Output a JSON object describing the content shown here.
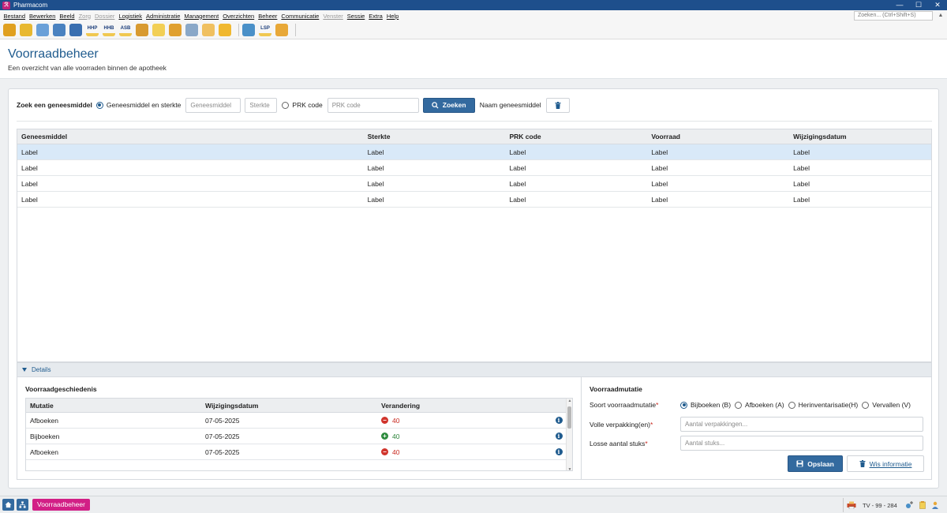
{
  "window": {
    "app_icon": "ℛ",
    "title": "Pharmacom",
    "controls": [
      "—",
      "☐",
      "✕"
    ]
  },
  "menu": {
    "items": [
      {
        "label": "Bestand",
        "disabled": false
      },
      {
        "label": "Bewerken",
        "disabled": false
      },
      {
        "label": "Beeld",
        "disabled": false
      },
      {
        "label": "Zorg",
        "disabled": true
      },
      {
        "label": "Dossier",
        "disabled": true
      },
      {
        "label": "Logistiek",
        "disabled": false
      },
      {
        "label": "Administratie",
        "disabled": false
      },
      {
        "label": "Management",
        "disabled": false
      },
      {
        "label": "Overzichten",
        "disabled": false
      },
      {
        "label": "Beheer",
        "disabled": false
      },
      {
        "label": "Communicatie",
        "disabled": false
      },
      {
        "label": "Venster",
        "disabled": true
      },
      {
        "label": "Sessie",
        "disabled": false
      },
      {
        "label": "Extra",
        "disabled": false
      },
      {
        "label": "Help",
        "disabled": false
      }
    ],
    "search_placeholder": "Zoeken... (Ctrl+Shift+S)"
  },
  "toolbar": {
    "icons": [
      {
        "name": "user-swap-icon",
        "text": "",
        "color": "#e0a020"
      },
      {
        "name": "coins-icon",
        "text": "",
        "color": "#e8b830"
      },
      {
        "name": "globe-add-icon",
        "text": "",
        "color": "#6aa0d8"
      },
      {
        "name": "patient-card-icon",
        "text": "",
        "color": "#4a82c0"
      },
      {
        "name": "document-blue-icon",
        "text": "",
        "color": "#3a6fb0"
      },
      {
        "name": "hhp-icon",
        "text": "HHP",
        "color": "#f0c850"
      },
      {
        "name": "hhb-icon",
        "text": "HHB",
        "color": "#f0c850"
      },
      {
        "name": "asb-icon",
        "text": "ASB",
        "color": "#f0c850"
      },
      {
        "name": "boxes-icon",
        "text": "",
        "color": "#d89a30"
      },
      {
        "name": "note-icon",
        "text": "",
        "color": "#f2cf55"
      },
      {
        "name": "package-icon",
        "text": "",
        "color": "#e0a030"
      },
      {
        "name": "person-doc-icon",
        "text": "",
        "color": "#8aa8c8"
      },
      {
        "name": "folder-user-icon",
        "text": "",
        "color": "#f0c060"
      },
      {
        "name": "envelope-icon",
        "text": "",
        "color": "#f0b830"
      },
      {
        "name": "people-icon",
        "text": "",
        "color": "#4a90c8"
      },
      {
        "name": "lsp-icon",
        "text": "LSP",
        "color": "#f0c850"
      },
      {
        "name": "user-icon",
        "text": "",
        "color": "#e8a838"
      }
    ]
  },
  "page": {
    "title": "Voorraadbeheer",
    "subtitle": "Een overzicht van alle voorraden binnen de apotheek"
  },
  "search": {
    "label": "Zoek een geneesmiddel",
    "option1": "Geneesmiddel en sterkte",
    "placeholder_geneesmiddel": "Geneesmiddel",
    "placeholder_sterkte": "Sterkte",
    "option2": "PRK code",
    "placeholder_prk": "PRK code",
    "search_button": "Zoeken",
    "name_label": "Naam geneesmiddel"
  },
  "grid": {
    "columns": [
      "Geneesmiddel",
      "Sterkte",
      "PRK code",
      "Voorraad",
      "Wijzigingsdatum"
    ],
    "rows": [
      [
        "Label",
        "Label",
        "Label",
        "Label",
        "Label"
      ],
      [
        "Label",
        "Label",
        "Label",
        "Label",
        "Label"
      ],
      [
        "Label",
        "Label",
        "Label",
        "Label",
        "Label"
      ],
      [
        "Label",
        "Label",
        "Label",
        "Label",
        "Label"
      ]
    ],
    "selected_row": 0
  },
  "details": {
    "label": "Details",
    "history": {
      "title": "Voorraadgeschiedenis",
      "columns": [
        "Mutatie",
        "Wijzigingsdatum",
        "Verandering"
      ],
      "rows": [
        {
          "mutatie": "Afboeken",
          "datum": "07-05-2025",
          "sign": "−",
          "value": "40",
          "type": "minus"
        },
        {
          "mutatie": "Bijboeken",
          "datum": "07-05-2025",
          "sign": "+",
          "value": "40",
          "type": "plus"
        },
        {
          "mutatie": "Afboeken",
          "datum": "07-05-2025",
          "sign": "−",
          "value": "40",
          "type": "minus"
        }
      ]
    },
    "mutation": {
      "title": "Voorraadmutatie",
      "soort_label": "Soort voorraadmutatie",
      "options": [
        "Bijboeken (B)",
        "Afboeken (A)",
        "Herinventarisatie(H)",
        "Vervallen (V)"
      ],
      "selected_option": 0,
      "volle_label": "Volle verpakking(en)",
      "volle_placeholder": "Aantal verpakkingen...",
      "losse_label": "Losse aantal stuks",
      "losse_placeholder": "Aantal stuks...",
      "required_mark": "*",
      "save_button": "Opslaan",
      "clear_button": "Wis informatie"
    }
  },
  "statusbar": {
    "active_tab": "Voorraadbeheer",
    "station": "TV - 99 - 284"
  },
  "colors": {
    "titlebar": "#1e4f8c",
    "accent": "#336a9f",
    "tab_pink": "#d21f86",
    "selected_row": "#d9e9f8",
    "negative": "#d0342c",
    "positive": "#2e8b3e"
  }
}
